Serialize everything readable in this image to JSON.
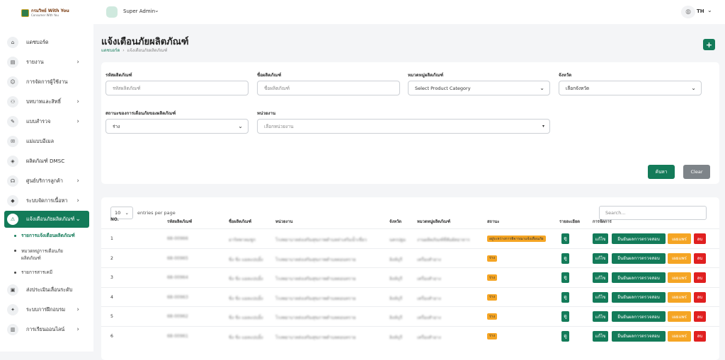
{
  "logo": {
    "title": "กรมวิทย์ With You",
    "subtitle": "Consumer With You"
  },
  "topbar": {
    "user": "Super Admin",
    "lang": "TH"
  },
  "sidebar": {
    "items": [
      {
        "label": "แดชบอร์ด",
        "icon": "home-icon",
        "chevron": false
      },
      {
        "label": "รายงาน",
        "icon": "report-icon",
        "chevron": true
      },
      {
        "label": "การจัดการผู้ใช้งาน",
        "icon": "users-icon",
        "chevron": false
      },
      {
        "label": "บทบาทและสิทธิ์",
        "icon": "role-icon",
        "chevron": true
      },
      {
        "label": "แบบสำรวจ",
        "icon": "survey-icon",
        "chevron": true
      },
      {
        "label": "แม่แบบอีเมล",
        "icon": "email-icon",
        "chevron": false
      },
      {
        "label": "ผลิตภัณฑ์ DMSC",
        "icon": "product-icon",
        "chevron": false
      },
      {
        "label": "ศูนย์บริการลูกค้า",
        "icon": "headset-icon",
        "chevron": true
      },
      {
        "label": "ระบบจัดการเนื้อหา",
        "icon": "cube-icon",
        "chevron": true
      },
      {
        "label": "แจ้งเตือนภัยผลิตภัณฑ์",
        "icon": "alert-icon",
        "chevron": true,
        "active": true
      }
    ],
    "subitems": [
      "รายการแจ้งเตือนผลิตภัณฑ์",
      "หมวดหมู่การเตือนภัย ผลิตภัณฑ์",
      "รายการสารเคมี"
    ],
    "items_after": [
      {
        "label": "ส่งประเมินเลื่อนระดับ",
        "icon": "box-icon"
      },
      {
        "label": "ระบบการฝึกอบรม",
        "icon": "training-icon",
        "chevron": true
      },
      {
        "label": "การเรียนออนไลน์",
        "icon": "book-icon",
        "chevron": true
      }
    ]
  },
  "page": {
    "title": "แจ้งเตือนภัยผลิตภัณฑ์",
    "breadcrumb_home": "แดชบอร์ด",
    "breadcrumb_current": "แจ้งเตือนภัยผลิตภัณฑ์",
    "add_label": "+"
  },
  "filter": {
    "code_label": "รหัสผลิตภัณฑ์",
    "code_placeholder": "รหัสผลิตภัณฑ์",
    "name_label": "ชื่อผลิตภัณฑ์",
    "name_placeholder": "ชื่อผลิตภัณฑ์",
    "category_label": "หมวดหมู่ผลิตภัณฑ์",
    "category_value": "Select Product Category",
    "province_label": "จังหวัด",
    "province_value": "เลือกจังหวัด",
    "status_label": "สถานะของการเตือนภัยของผลิตภัณฑ์",
    "status_value": "ร่าง",
    "agency_label": "หน่วยงาน",
    "agency_placeholder": "เลือกหน่วยงาน",
    "search_btn": "ค้นหา",
    "clear_btn": "Clear"
  },
  "table": {
    "entries_value": "10",
    "entries_label": "entries per page",
    "search_placeholder": "Search...",
    "headers": [
      "NO.",
      "รหัสผลิตภัณฑ์",
      "ชื่อผลิตภัณฑ์",
      "หน่วยงาน",
      "จังหวัด",
      "หมวดหมู่ผลิตภัณฑ์",
      "สถานะ",
      "รายละเอียด",
      "การจัดการ"
    ],
    "btn_view": "ดู",
    "btn_edit": "แก้ไข",
    "btn_confirm": "ยืนยันผลการตรวจสอบ",
    "btn_publish": "เผยแพร่",
    "btn_delete": "ลบ",
    "rows": [
      {
        "no": "1",
        "code": "68-00966",
        "name": "อาร์ทพาลมซูก",
        "agency": "โรงพยาบาลส่งเสริมสุขภาพตำบลท่าเสริมน้ำเชี่ยว",
        "province": "นครปฐม",
        "category": "งานผลิตภัณฑ์ที่สัมผัสอาหาร",
        "status": "อยู่ระหว่างการพิจารณาแจ้งเตือนภัย",
        "status_color": "#f5a524"
      },
      {
        "no": "2",
        "code": "68-00965",
        "name": "ชิ่ง ชิ่ง แอลแปบอิ้ง",
        "agency": "โรงพยาบาลส่งเสริมสุขภาพตำบลดอนทราย",
        "province": "ลิงห์บุรี",
        "category": "เครื่องสำอาง",
        "status": "ร่าง",
        "status_color": "#f5a524"
      },
      {
        "no": "3",
        "code": "68-00964",
        "name": "ชิ่ง ชิ่ง แอลแปบอิ้ง",
        "agency": "โรงพยาบาลส่งเสริมสุขภาพตำบลดอนทราย",
        "province": "ลิงห์บุรี",
        "category": "เครื่องสำอาง",
        "status": "ร่าง",
        "status_color": "#f5a524"
      },
      {
        "no": "4",
        "code": "68-00963",
        "name": "ชิ่ง ชิ่ง แอลแปบอิ้ง",
        "agency": "โรงพยาบาลส่งเสริมสุขภาพตำบลดอนทราย",
        "province": "ลิงห์บุรี",
        "category": "เครื่องสำอาง",
        "status": "ร่าง",
        "status_color": "#f5a524"
      },
      {
        "no": "5",
        "code": "68-00962",
        "name": "ชิ่ง ชิ่ง แอลแปบอิ้ง",
        "agency": "โรงพยาบาลส่งเสริมสุขภาพตำบลดอนทราย",
        "province": "ลิงห์บุรี",
        "category": "เครื่องสำอาง",
        "status": "ร่าง",
        "status_color": "#f5a524"
      },
      {
        "no": "6",
        "code": "68-00961",
        "name": "ชิ่ง ชิ่ง แอลแปบอิ้ง",
        "agency": "โรงพยาบาลส่งเสริมสุขภาพตำบลดอนทราย",
        "province": "ลิงห์บุรี",
        "category": "เครื่องสำอาง",
        "status": "ร่าง",
        "status_color": "#f5a524"
      }
    ]
  }
}
